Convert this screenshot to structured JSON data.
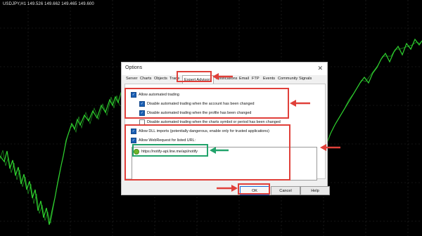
{
  "chart": {
    "ticker": "USDJPY,H1  149.526 149.662 149.465 149.600",
    "colors": {
      "background": "#000000",
      "candles": "#2fd12f",
      "grid": "#2a2a2a"
    }
  },
  "dialog": {
    "title": "Options",
    "close_icon": "close-icon",
    "tabs": [
      {
        "label": "Server"
      },
      {
        "label": "Charts"
      },
      {
        "label": "Objects"
      },
      {
        "label": "Trade"
      },
      {
        "label": "Expert Advisors"
      },
      {
        "label": "Notifications"
      },
      {
        "label": "Email"
      },
      {
        "label": "FTP"
      },
      {
        "label": "Events"
      },
      {
        "label": "Community"
      },
      {
        "label": "Signals"
      }
    ],
    "active_tab": "Expert Advisors",
    "options": [
      {
        "label": "Allow automated trading",
        "checked": true
      },
      {
        "label": "Disable automated trading when the account has been changed",
        "checked": true
      },
      {
        "label": "Disable automated trading when the profile has been changed",
        "checked": true
      },
      {
        "label": "Disable automated trading when the charts symbol or period has been changed",
        "checked": false
      },
      {
        "label": "Allow DLL imports (potentially dangerous, enable only for trusted applications)",
        "checked": true
      },
      {
        "label": "Allow WebRequest for listed URL:",
        "checked": true
      }
    ],
    "url_list": [
      {
        "url": "https://notify-api.line.me/api/notify",
        "icon": "green-circle-icon"
      }
    ],
    "buttons": {
      "ok": "OK",
      "cancel": "Cancel",
      "help": "Help"
    }
  },
  "annotations": {
    "highlight_color": "#e0403a",
    "url_highlight_color": "#22a36b"
  }
}
